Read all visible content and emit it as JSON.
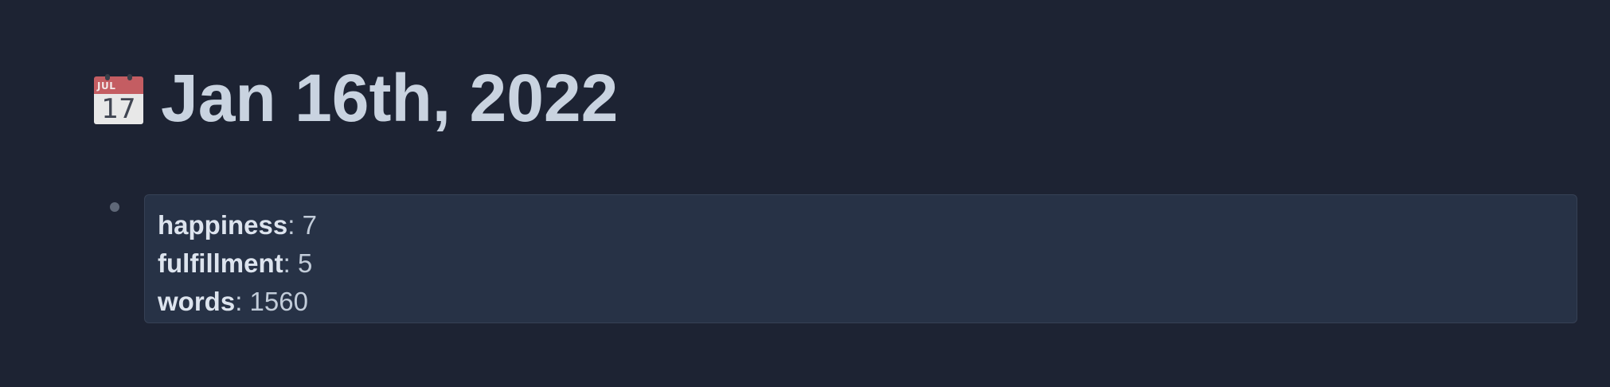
{
  "page": {
    "title": "Jan 16th, 2022",
    "icon": {
      "name": "calendar-icon",
      "month": "JUL",
      "day": "17"
    }
  },
  "block": {
    "properties": [
      {
        "key": "happiness",
        "separator": ":",
        "value": "7"
      },
      {
        "key": "fulfillment",
        "separator": ":",
        "value": "5"
      },
      {
        "key": "words",
        "separator": ":",
        "value": "1560"
      }
    ]
  },
  "colors": {
    "background": "#1d2333",
    "block_background": "#273246",
    "title_text": "#c9d3e0",
    "calendar_red": "#c45d62"
  }
}
